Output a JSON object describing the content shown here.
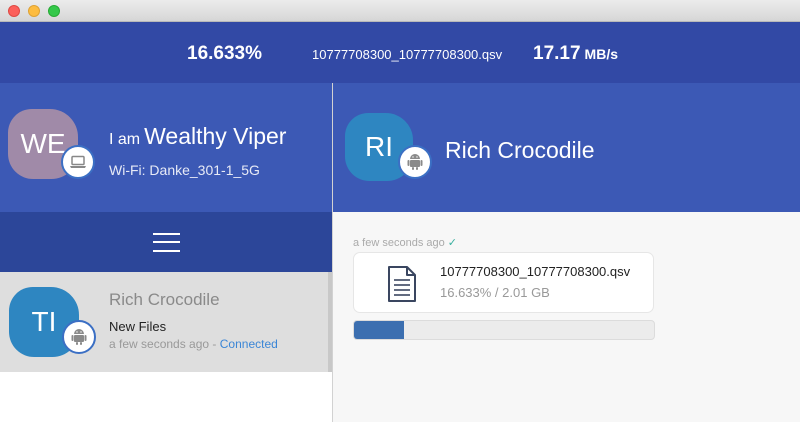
{
  "window": {
    "controls": [
      "close",
      "minimize",
      "maximize"
    ]
  },
  "transfer_status": {
    "percent": "16.633%",
    "file_name": "10777708300_10777708300.qsv",
    "speed_value": "17.17",
    "speed_unit": "MB/s"
  },
  "me": {
    "initials": "WE",
    "prefix": "I am",
    "name": "Wealthy Viper",
    "wifi": "Wi-Fi: Danke_301-1_5G",
    "device_icon": "laptop-icon"
  },
  "menu": {
    "icon": "hamburger-menu-icon"
  },
  "devices": [
    {
      "initials": "TI",
      "name": "Rich Crocodile",
      "message": "New Files",
      "time": "a few seconds ago",
      "separator": " - ",
      "status": "Connected",
      "device_icon": "android-icon"
    }
  ],
  "peer": {
    "initials": "RI",
    "name": "Rich Crocodile",
    "device_icon": "android-icon"
  },
  "messages": [
    {
      "time": "a few seconds ago",
      "check": "✓",
      "file_icon": "document-icon",
      "file_name": "10777708300_10777708300.qsv",
      "progress_text": "16.633% / 2.01 GB",
      "progress_fraction": 0.16633
    }
  ],
  "colors": {
    "header_blue": "#3c59b5",
    "status_blue": "#3249a5",
    "menu_blue": "#2c4699",
    "avatar_blue": "#2e86c1",
    "avatar_purple": "#a08aa8",
    "progress_blue": "#3c6fb0",
    "connected_link": "#3b86d6"
  }
}
